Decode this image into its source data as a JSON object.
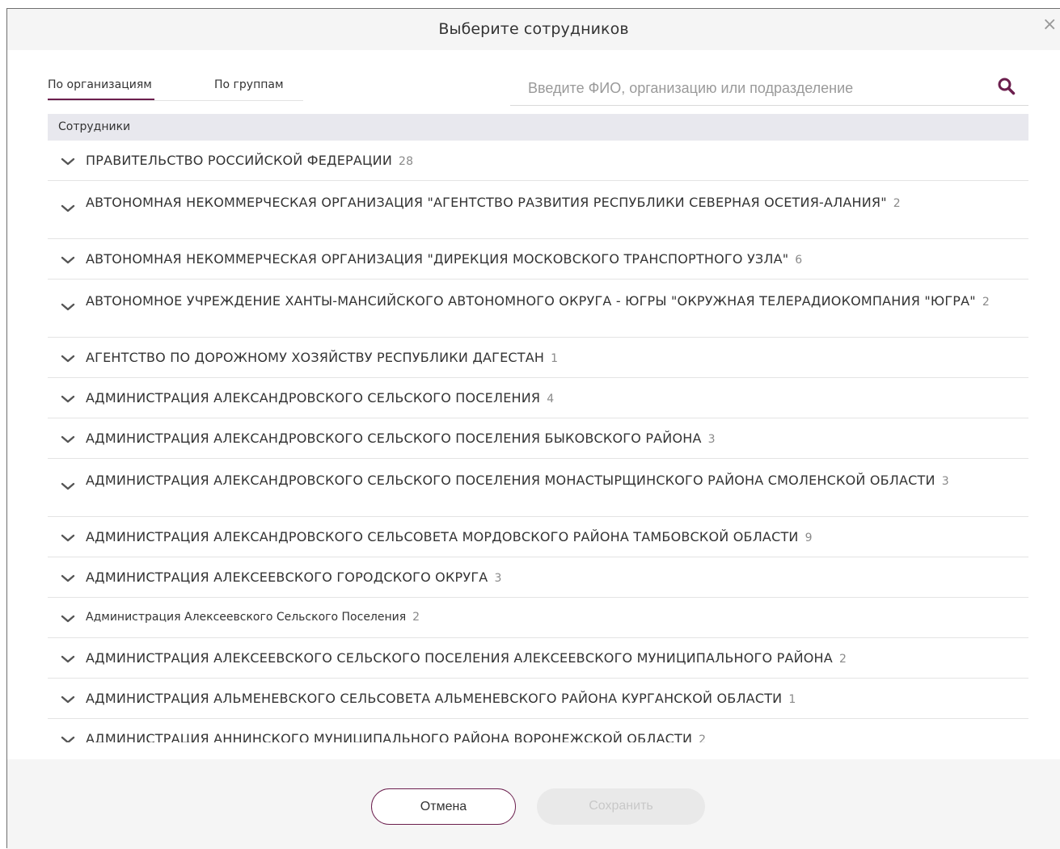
{
  "dialog": {
    "title": "Выберите сотрудников",
    "close_glyph": "×"
  },
  "tabs": [
    {
      "label": "По организациям",
      "active": true
    },
    {
      "label": "По группам",
      "active": false
    }
  ],
  "search": {
    "placeholder": "Введите ФИО, организацию или подразделение",
    "value": ""
  },
  "list": {
    "header": "Сотрудники",
    "items": [
      {
        "name": "ПРАВИТЕЛЬСТВО РОССИЙСКОЙ ФЕДЕРАЦИИ",
        "count": "28"
      },
      {
        "name": "АВТОНОМНАЯ НЕКОММЕРЧЕСКАЯ ОРГАНИЗАЦИЯ \"АГЕНТСТВО РАЗВИТИЯ РЕСПУБЛИКИ СЕВЕРНАЯ ОСЕТИЯ-АЛАНИЯ\"",
        "count": "2"
      },
      {
        "name": "АВТОНОМНАЯ НЕКОММЕРЧЕСКАЯ ОРГАНИЗАЦИЯ \"ДИРЕКЦИЯ МОСКОВСКОГО ТРАНСПОРТНОГО УЗЛА\"",
        "count": "6"
      },
      {
        "name": "АВТОНОМНОЕ УЧРЕЖДЕНИЕ ХАНТЫ-МАНСИЙСКОГО АВТОНОМНОГО ОКРУГА - ЮГРЫ \"ОКРУЖНАЯ ТЕЛЕРАДИОКОМПАНИЯ \"ЮГРА\"",
        "count": "2"
      },
      {
        "name": "АГЕНТСТВО ПО ДОРОЖНОМУ ХОЗЯЙСТВУ РЕСПУБЛИКИ ДАГЕСТАН",
        "count": "1"
      },
      {
        "name": "АДМИНИСТРАЦИЯ АЛЕКСАНДРОВСКОГО СЕЛЬСКОГО ПОСЕЛЕНИЯ",
        "count": "4"
      },
      {
        "name": "АДМИНИСТРАЦИЯ АЛЕКСАНДРОВСКОГО СЕЛЬСКОГО ПОСЕЛЕНИЯ БЫКОВСКОГО РАЙОНА",
        "count": "3"
      },
      {
        "name": "АДМИНИСТРАЦИЯ АЛЕКСАНДРОВСКОГО СЕЛЬСКОГО ПОСЕЛЕНИЯ МОНАСТЫРЩИНСКОГО РАЙОНА СМОЛЕНСКОЙ ОБЛАСТИ",
        "count": "3"
      },
      {
        "name": "АДМИНИСТРАЦИЯ АЛЕКСАНДРОВСКОГО СЕЛЬСОВЕТА МОРДОВСКОГО РАЙОНА ТАМБОВСКОЙ ОБЛАСТИ",
        "count": "9"
      },
      {
        "name": "АДМИНИСТРАЦИЯ АЛЕКСЕЕВСКОГО ГОРОДСКОГО ОКРУГА",
        "count": "3"
      },
      {
        "name": "Администрация Алексеевского Сельского Поселения",
        "count": "2"
      },
      {
        "name": "АДМИНИСТРАЦИЯ АЛЕКСЕЕВСКОГО СЕЛЬСКОГО ПОСЕЛЕНИЯ АЛЕКСЕЕВСКОГО МУНИЦИПАЛЬНОГО РАЙОНА",
        "count": "2"
      },
      {
        "name": "АДМИНИСТРАЦИЯ АЛЬМЕНЕВСКОГО СЕЛЬСОВЕТА АЛЬМЕНЕВСКОГО РАЙОНА КУРГАНСКОЙ ОБЛАСТИ",
        "count": "1"
      },
      {
        "name": "АДМИНИСТРАЦИЯ АННИНСКОГО МУНИЦИПАЛЬНОГО РАЙОНА ВОРОНЕЖСКОЙ ОБЛАСТИ",
        "count": "2"
      }
    ]
  },
  "footer": {
    "cancel_label": "Отмена",
    "save_label": "Сохранить"
  },
  "colors": {
    "accent": "#6b1e4d",
    "header_bg": "#f5f5f5",
    "list_header_bg": "#e8e8ee",
    "disabled_text": "#c8c8c8"
  },
  "icons": {
    "close": "close-icon",
    "search": "search-icon",
    "expand": "chevron-down-icon"
  }
}
